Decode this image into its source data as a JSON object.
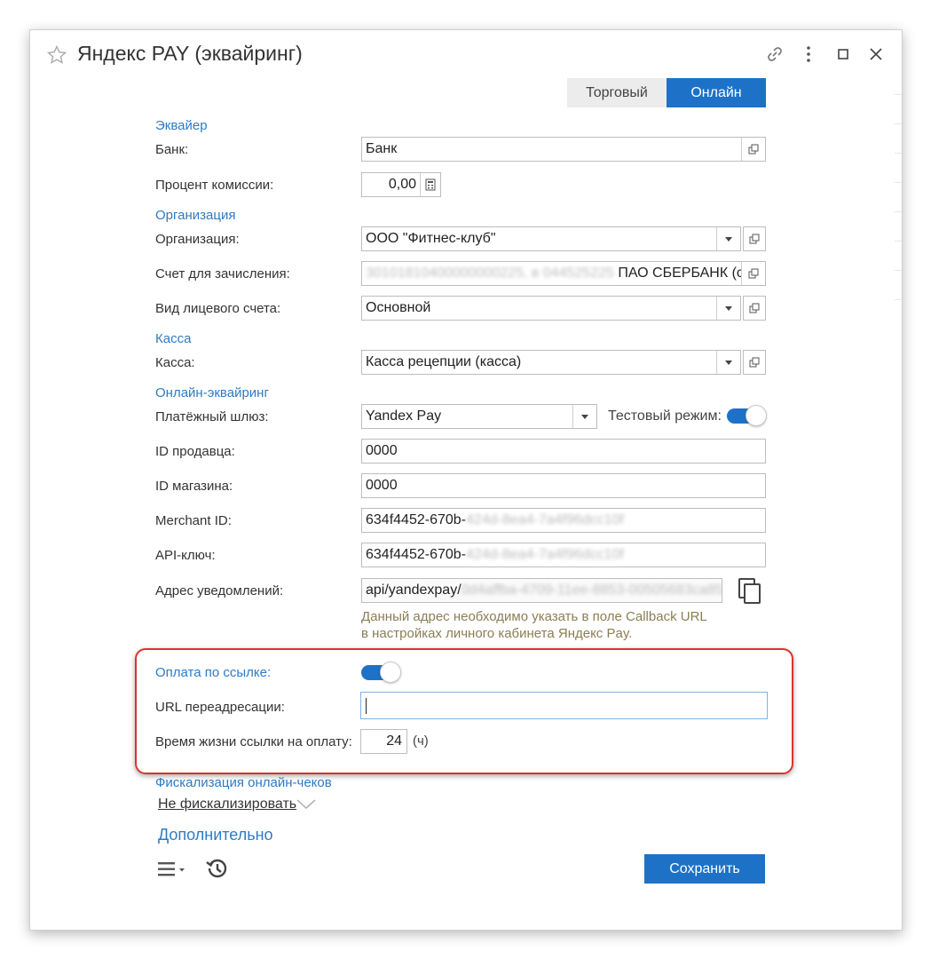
{
  "window": {
    "title": "Яндекс PAY (эквайринг)"
  },
  "tabs": [
    {
      "label": "Торговый"
    },
    {
      "label": "Онлайн"
    }
  ],
  "sections": {
    "acquirer": "Эквайер",
    "organization": "Организация",
    "cash": "Касса",
    "online": "Онлайн-эквайринг",
    "fiscal": "Фискализация онлайн-чеков",
    "more": "Дополнительно"
  },
  "fields": {
    "bank": {
      "label": "Банк:",
      "value": "Банк"
    },
    "commission": {
      "label": "Процент комиссии:",
      "value": "0,00"
    },
    "organization": {
      "label": "Организация:",
      "value": "ООО \"Фитнес-клуб\""
    },
    "account": {
      "label": "Счет для зачисления:",
      "value_hidden": "30101810400000000225, в 044525225",
      "value_visible": " ПАО СБЕРБАНК (с"
    },
    "account_type": {
      "label": "Вид лицевого счета:",
      "value": "Основной"
    },
    "cashbox": {
      "label": "Касса:",
      "value": "Касса рецепции (касса)"
    },
    "gateway": {
      "label": "Платёжный шлюз:",
      "value": "Yandex Pay"
    },
    "test_mode": {
      "label": "Тестовый режим:",
      "on": true
    },
    "seller_id": {
      "label": "ID продавца:",
      "value": "0000"
    },
    "shop_id": {
      "label": "ID магазина:",
      "value": "0000"
    },
    "merchant_id": {
      "label": "Merchant ID:",
      "value_visible": "634f4452-670b-",
      "value_hidden": "424d-8ea4-7a4f96dcc10f"
    },
    "api_key": {
      "label": "API-ключ:",
      "value_visible": "634f4452-670b-",
      "value_hidden": "424d-8ea4-7a4f96dcc10f"
    },
    "notify_url": {
      "label": "Адрес уведомлений:",
      "value_visible": "api/yandexpay/",
      "value_hidden": "0d4affba-4709-11ee-8853-00505683ca85"
    },
    "notify_hint_1": "Данный адрес необходимо указать в поле Callback URL",
    "notify_hint_2": "в настройках личного кабинета Яндекс Pay.",
    "pay_by_link": {
      "label": "Оплата по ссылке:",
      "on": true
    },
    "redirect_url": {
      "label": "URL переадресации:",
      "value": ""
    },
    "link_lifetime": {
      "label": "Время жизни ссылки на оплату:",
      "value": "24",
      "unit": "(ч)"
    },
    "fiscal_mode": {
      "value": "Не фискализировать"
    }
  },
  "footer": {
    "save_label": "Сохранить"
  },
  "colors": {
    "accent": "#1d72c7",
    "section": "#2e7bc4",
    "highlight": "#d9342f",
    "hint": "#8b7d55"
  }
}
